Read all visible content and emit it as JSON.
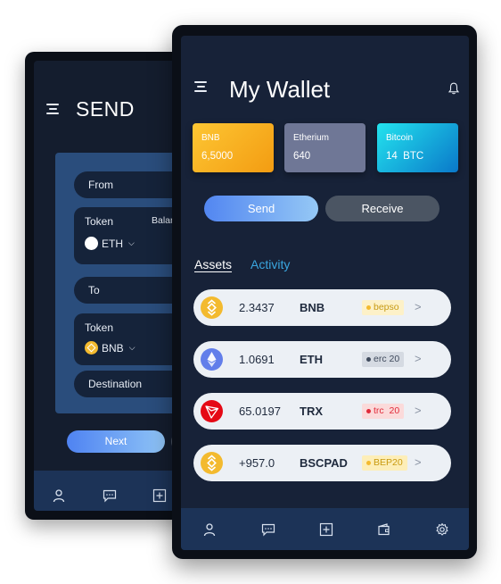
{
  "send_screen": {
    "title": "SEND",
    "from_label": "From",
    "token_label": "Token",
    "balance_label": "Balance",
    "from_token": "ETH",
    "to_label": "To",
    "to_token_label": "Token",
    "to_token": "BNB",
    "destination_label": "Destination",
    "next_label": "Next",
    "nav_icons": [
      "user-icon",
      "chat-icon",
      "plus-square-icon"
    ]
  },
  "wallet": {
    "title": "My Wallet",
    "bell_icon": "bell-icon",
    "cards": [
      {
        "name": "BNB",
        "value": "6,5000",
        "color": "#fdc633"
      },
      {
        "name": "Etherium",
        "value": "640",
        "color": "#6f7796"
      },
      {
        "name": "Bitcoin",
        "value": "14  BTC",
        "color": "#23e3ee"
      }
    ],
    "send_label": "Send",
    "receive_label": "Receive",
    "tabs": {
      "assets": "Assets",
      "activity": "Activity"
    },
    "assets": [
      {
        "amount": "2.3437",
        "symbol": "BNB",
        "tag": "bepso",
        "arrow": ">"
      },
      {
        "amount": "1.0691",
        "symbol": "ETH",
        "tag": "erc 20",
        "arrow": ">"
      },
      {
        "amount": "65.0197",
        "symbol": "TRX",
        "tag": "trc  20",
        "arrow": ">"
      },
      {
        "amount": "+957.0",
        "symbol": "BSCPAD",
        "tag": "BEP20",
        "arrow": ">"
      }
    ],
    "nav_icons": [
      "user-icon",
      "chat-icon",
      "plus-square-icon",
      "wallet-icon",
      "settings-icon"
    ]
  },
  "colors": {
    "accent_blue": "#5286f1",
    "bnb_yellow": "#f3ba2f",
    "navy": "#172238"
  }
}
